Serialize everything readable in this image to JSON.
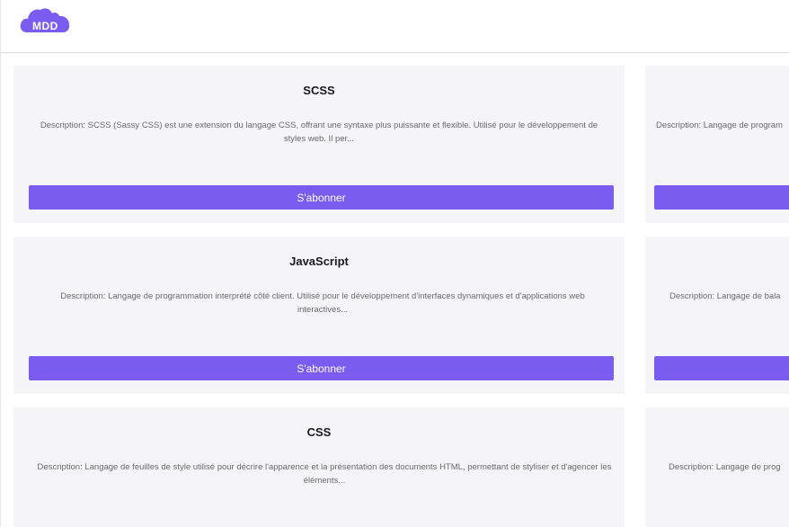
{
  "header": {
    "logo_text": "MDD",
    "logo_color": "#7b5cf0"
  },
  "accent_color": "#7b5cf0",
  "topics": [
    {
      "title": "SCSS",
      "description": "Description: SCSS (Sassy CSS) est une extension du langage CSS, offrant une syntaxe plus puissante et flexible. Utilisé pour le développement de styles web. Il per...",
      "button_label": "S'abonner"
    },
    {
      "title": "",
      "description": "Description: Langage de program",
      "button_label": ""
    },
    {
      "title": "JavaScript",
      "description": "Description: Langage de programmation interprété côté client. Utilisé pour le développement d'interfaces dynamiques et d'applications web interactives...",
      "button_label": "S'abonner"
    },
    {
      "title": "",
      "description": "Description: Langage de bala",
      "button_label": ""
    },
    {
      "title": "CSS",
      "description": "Description: Langage de feuilles de style utilisé pour décrire l'apparence et la présentation des documents HTML, permettant de styliser et d'agencer les éléments...",
      "button_label": ""
    },
    {
      "title": "",
      "description": "Description: Langage de prog",
      "button_label": ""
    }
  ]
}
